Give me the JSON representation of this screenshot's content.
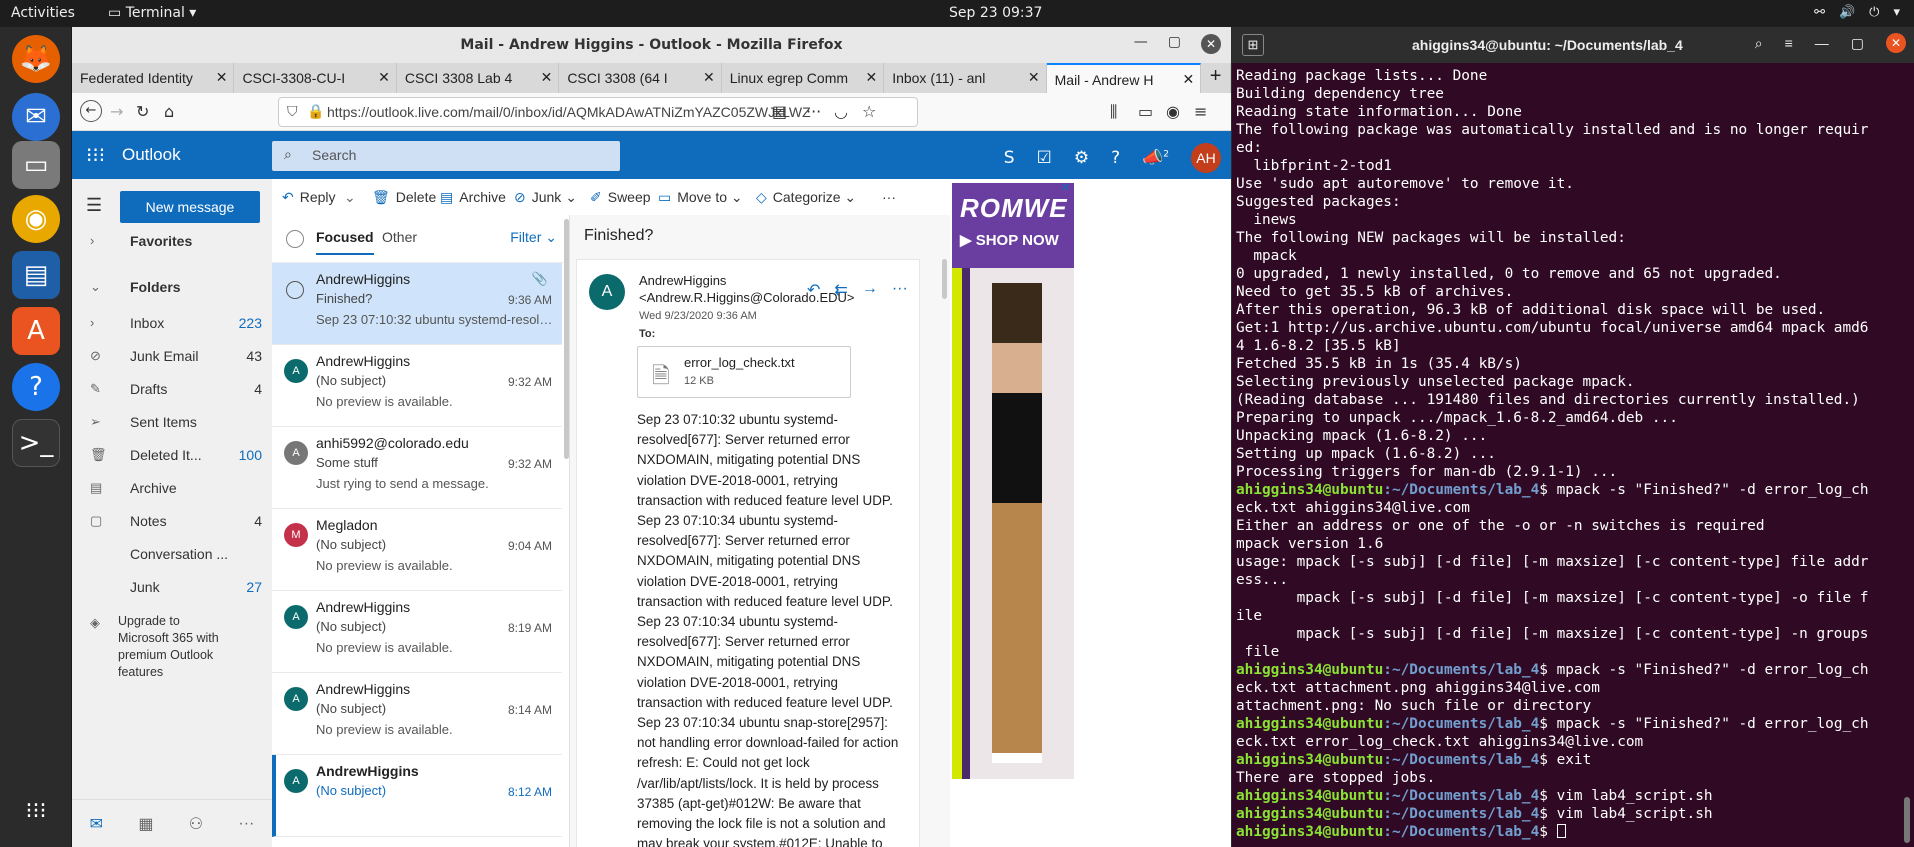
{
  "topbar": {
    "activities": "Activities",
    "app": "Terminal",
    "clock": "Sep 23  09:37"
  },
  "dock": {
    "items": [
      "firefox-icon",
      "thunderbird-icon",
      "files-icon",
      "rhythmbox-icon",
      "writer-icon",
      "software-icon",
      "help-icon",
      "terminal-icon",
      "apps-grid-icon"
    ]
  },
  "firefox": {
    "title": "Mail - Andrew Higgins - Outlook - Mozilla Firefox",
    "tabs": [
      {
        "label": "Federated Identity"
      },
      {
        "label": "CSCI-3308-CU-I"
      },
      {
        "label": "CSCI 3308 Lab 4"
      },
      {
        "label": "CSCI 3308 (64 I"
      },
      {
        "label": "Linux egrep Comm"
      },
      {
        "label": "Inbox (11) - anl"
      },
      {
        "label": "Mail - Andrew H"
      }
    ],
    "url": "https://outlook.live.com/mail/0/inbox/id/AQMkADAwATNiZmYAZC05ZWJkLWZ"
  },
  "outlook": {
    "brand": "Outlook",
    "search_placeholder": "Search",
    "avatar": "AH",
    "badge": "2",
    "new_message": "New message",
    "folders": [
      {
        "label": "Favorites",
        "count": ""
      },
      {
        "label": "Folders",
        "count": ""
      },
      {
        "label": "Inbox",
        "count": "223"
      },
      {
        "label": "Junk Email",
        "count": "43"
      },
      {
        "label": "Drafts",
        "count": "4"
      },
      {
        "label": "Sent Items",
        "count": ""
      },
      {
        "label": "Deleted It...",
        "count": "100"
      },
      {
        "label": "Archive",
        "count": ""
      },
      {
        "label": "Notes",
        "count": "4"
      },
      {
        "label": "Conversation ...",
        "count": ""
      },
      {
        "label": "Junk",
        "count": "27"
      }
    ],
    "upgrade": "Upgrade to Microsoft 365 with premium Outlook features",
    "toolbar": {
      "reply": "Reply",
      "delete": "Delete",
      "archive": "Archive",
      "junk": "Junk",
      "sweep": "Sweep",
      "move_to": "Move to",
      "categorize": "Categorize",
      "more": "···"
    },
    "list_tabs": {
      "focused": "Focused",
      "other": "Other",
      "filter": "Filter"
    },
    "messages": [
      {
        "from": "AndrewHiggins",
        "subject": "Finished?",
        "time": "9:36 AM",
        "preview": "Sep 23 07:10:32 ubuntu systemd-resolved[...",
        "avatar": ""
      },
      {
        "from": "AndrewHiggins",
        "subject": "(No subject)",
        "time": "9:32 AM",
        "preview": "No preview is available.",
        "avatar": "A"
      },
      {
        "from": "anhi5992@colorado.edu",
        "subject": "Some stuff",
        "time": "9:32 AM",
        "preview": "Just rying to send a message.",
        "avatar": "A"
      },
      {
        "from": "Megladon",
        "subject": "(No subject)",
        "time": "9:04 AM",
        "preview": "No preview is available.",
        "avatar": "M"
      },
      {
        "from": "AndrewHiggins",
        "subject": "(No subject)",
        "time": "8:19 AM",
        "preview": "No preview is available.",
        "avatar": "A"
      },
      {
        "from": "AndrewHiggins",
        "subject": "(No subject)",
        "time": "8:14 AM",
        "preview": "No preview is available.",
        "avatar": "A"
      },
      {
        "from": "AndrewHiggins",
        "subject": "(No subject)",
        "time": "8:12 AM",
        "preview": "",
        "avatar": "A"
      }
    ],
    "reading": {
      "subject": "Finished?",
      "avatar": "A",
      "from": "AndrewHiggins <Andrew.R.Higgins@Colorado.EDU>",
      "date": "Wed 9/23/2020 9:36 AM",
      "to": "To:",
      "attachment_name": "error_log_check.txt",
      "attachment_size": "12 KB",
      "body": "Sep 23 07:10:32 ubuntu systemd-resolved[677]: Server returned error NXDOMAIN, mitigating potential DNS violation DVE-2018-0001, retrying transaction with reduced feature level UDP. Sep 23 07:10:34 ubuntu systemd-resolved[677]: Server returned error NXDOMAIN, mitigating potential DNS violation DVE-2018-0001, retrying transaction with reduced feature level UDP. Sep 23 07:10:34 ubuntu systemd-resolved[677]: Server returned error NXDOMAIN, mitigating potential DNS violation DVE-2018-0001, retrying transaction with reduced feature level UDP. Sep 23 07:10:34 ubuntu snap-store[2957]: not handling error download-failed for action refresh: E: Could not get lock /var/lib/apt/lists/lock. It is held by process 37385 (apt-get)#012W: Be aware that removing the lock file is not a solution and may break your system.#012E: Unable to lock directory /var/lib/apt/lists/"
    },
    "ad": {
      "brand": "ROMWE",
      "cta": "▶ SHOP NOW"
    }
  },
  "terminal": {
    "title": "ahiggins34@ubuntu: ~/Documents/lab_4",
    "prompt_user": "ahiggins34@ubuntu",
    "prompt_path": ":~/Documents/lab_4",
    "lines": [
      {
        "type": "out",
        "text": "Reading package lists... Done"
      },
      {
        "type": "out",
        "text": "Building dependency tree"
      },
      {
        "type": "out",
        "text": "Reading state information... Done"
      },
      {
        "type": "out",
        "text": "The following package was automatically installed and is no longer requir"
      },
      {
        "type": "out",
        "text": "ed:"
      },
      {
        "type": "out",
        "text": "  libfprint-2-tod1"
      },
      {
        "type": "out",
        "text": "Use 'sudo apt autoremove' to remove it."
      },
      {
        "type": "out",
        "text": "Suggested packages:"
      },
      {
        "type": "out",
        "text": "  inews"
      },
      {
        "type": "out",
        "text": "The following NEW packages will be installed:"
      },
      {
        "type": "out",
        "text": "  mpack"
      },
      {
        "type": "out",
        "text": "0 upgraded, 1 newly installed, 0 to remove and 65 not upgraded."
      },
      {
        "type": "out",
        "text": "Need to get 35.5 kB of archives."
      },
      {
        "type": "out",
        "text": "After this operation, 96.3 kB of additional disk space will be used."
      },
      {
        "type": "out",
        "text": "Get:1 http://us.archive.ubuntu.com/ubuntu focal/universe amd64 mpack amd6"
      },
      {
        "type": "out",
        "text": "4 1.6-8.2 [35.5 kB]"
      },
      {
        "type": "out",
        "text": "Fetched 35.5 kB in 1s (35.4 kB/s)"
      },
      {
        "type": "out",
        "text": "Selecting previously unselected package mpack."
      },
      {
        "type": "out",
        "text": "(Reading database ... 191480 files and directories currently installed.)"
      },
      {
        "type": "out",
        "text": "Preparing to unpack .../mpack_1.6-8.2_amd64.deb ..."
      },
      {
        "type": "out",
        "text": "Unpacking mpack (1.6-8.2) ..."
      },
      {
        "type": "out",
        "text": "Setting up mpack (1.6-8.2) ..."
      },
      {
        "type": "out",
        "text": "Processing triggers for man-db (2.9.1-1) ..."
      },
      {
        "type": "cmd",
        "text": "$ mpack -s \"Finished?\" -d error_log_ch"
      },
      {
        "type": "out",
        "text": "eck.txt ahiggins34@live.com"
      },
      {
        "type": "out",
        "text": "Either an address or one of the -o or -n switches is required"
      },
      {
        "type": "out",
        "text": "mpack version 1.6"
      },
      {
        "type": "out",
        "text": "usage: mpack [-s subj] [-d file] [-m maxsize] [-c content-type] file addr"
      },
      {
        "type": "out",
        "text": "ess..."
      },
      {
        "type": "out",
        "text": "       mpack [-s subj] [-d file] [-m maxsize] [-c content-type] -o file f"
      },
      {
        "type": "out",
        "text": "ile"
      },
      {
        "type": "out",
        "text": "       mpack [-s subj] [-d file] [-m maxsize] [-c content-type] -n groups"
      },
      {
        "type": "out",
        "text": " file"
      },
      {
        "type": "cmd",
        "text": "$ mpack -s \"Finished?\" -d error_log_ch"
      },
      {
        "type": "out",
        "text": "eck.txt attachment.png ahiggins34@live.com"
      },
      {
        "type": "out",
        "text": "attachment.png: No such file or directory"
      },
      {
        "type": "cmd",
        "text": "$ mpack -s \"Finished?\" -d error_log_ch"
      },
      {
        "type": "out",
        "text": "eck.txt error_log_check.txt ahiggins34@live.com"
      },
      {
        "type": "cmd",
        "text": "$ exit"
      },
      {
        "type": "out",
        "text": "There are stopped jobs."
      },
      {
        "type": "cmd",
        "text": "$ vim lab4_script.sh"
      },
      {
        "type": "cmd",
        "text": "$ vim lab4_script.sh"
      },
      {
        "type": "cmd",
        "text": "$ "
      }
    ]
  }
}
